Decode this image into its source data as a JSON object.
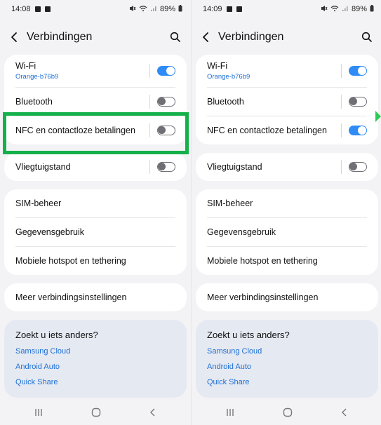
{
  "screens": [
    {
      "status": {
        "time": "14:08",
        "battery": "89%"
      },
      "header": {
        "title": "Verbindingen"
      },
      "items": {
        "wifi": {
          "label": "Wi-Fi",
          "sub": "Orange-b76b9",
          "state": "on"
        },
        "bluetooth": {
          "label": "Bluetooth",
          "state": "off"
        },
        "nfc": {
          "label": "NFC en contactloze betalingen",
          "state": "off"
        },
        "flight": {
          "label": "Vliegtuigstand",
          "state": "off"
        },
        "sim": {
          "label": "SIM-beheer"
        },
        "data": {
          "label": "Gegevensgebruik"
        },
        "hotspot": {
          "label": "Mobiele hotspot en tethering"
        },
        "more": {
          "label": "Meer verbindingsinstellingen"
        }
      },
      "search": {
        "question": "Zoekt u iets anders?",
        "links": [
          "Samsung Cloud",
          "Android Auto",
          "Quick Share"
        ]
      }
    },
    {
      "status": {
        "time": "14:09",
        "battery": "89%"
      },
      "header": {
        "title": "Verbindingen"
      },
      "items": {
        "wifi": {
          "label": "Wi-Fi",
          "sub": "Orange-b76b9",
          "state": "on"
        },
        "bluetooth": {
          "label": "Bluetooth",
          "state": "off"
        },
        "nfc": {
          "label": "NFC en contactloze betalingen",
          "state": "on"
        },
        "flight": {
          "label": "Vliegtuigstand",
          "state": "off"
        },
        "sim": {
          "label": "SIM-beheer"
        },
        "data": {
          "label": "Gegevensgebruik"
        },
        "hotspot": {
          "label": "Mobiele hotspot en tethering"
        },
        "more": {
          "label": "Meer verbindingsinstellingen"
        }
      },
      "search": {
        "question": "Zoekt u iets anders?",
        "links": [
          "Samsung Cloud",
          "Android Auto",
          "Quick Share"
        ]
      }
    }
  ],
  "colors": {
    "accent": "#2f8cf6",
    "link": "#1c6fd6",
    "highlight": "#14b04a",
    "background": "#f3f3f5"
  }
}
